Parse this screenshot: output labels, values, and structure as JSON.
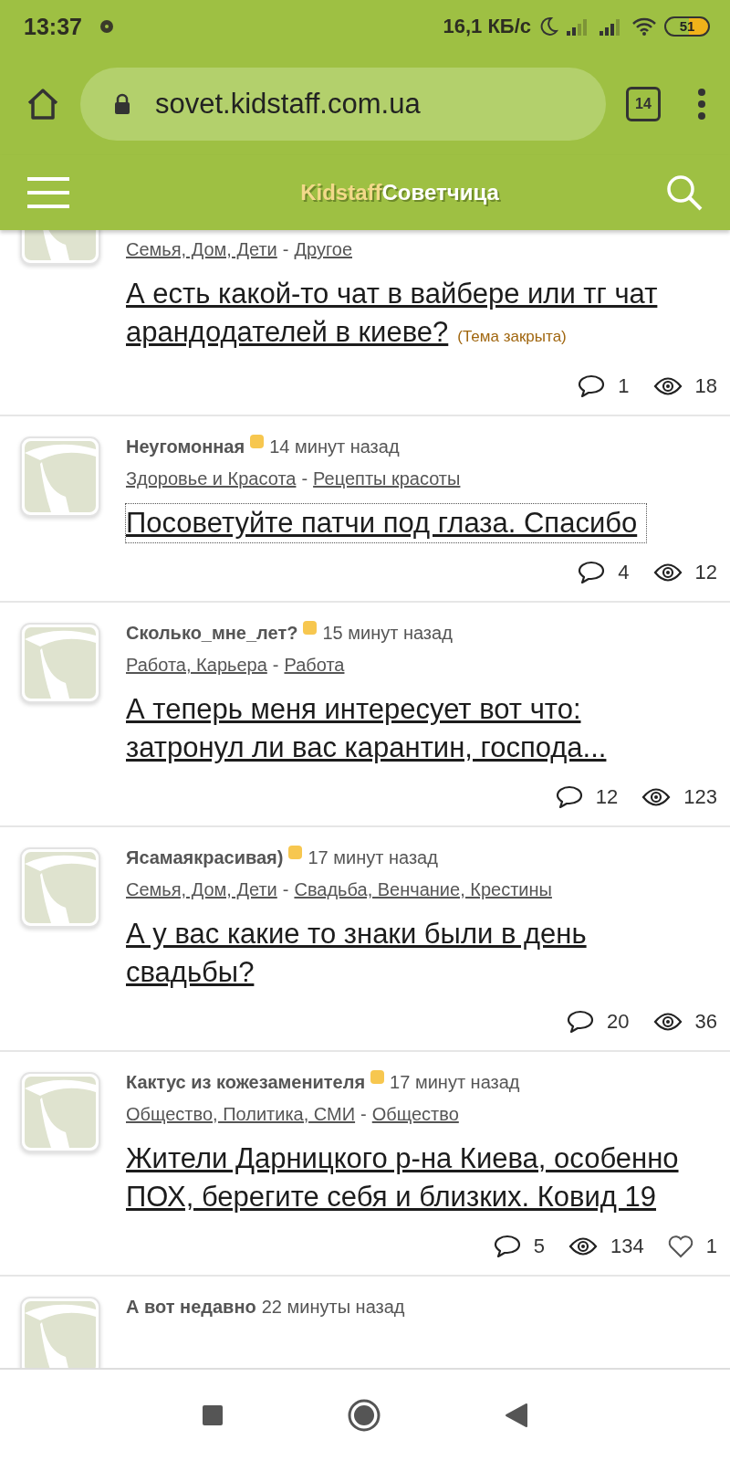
{
  "status_bar": {
    "time": "13:37",
    "speed": "16,1 КБ/с",
    "battery": "51"
  },
  "browser": {
    "url": "sovet.kidstaff.com.ua",
    "tabs_count": "14"
  },
  "site_header": {
    "logo_part1": "Kidstaff",
    "logo_part2": "Советчица"
  },
  "posts": [
    {
      "categories": [
        "Семья, Дом, Дети",
        "Другое"
      ],
      "separator": "-",
      "title_lines": [
        "А есть какой-то чат в вайбере или тг чат",
        "арандодателей в киеве?"
      ],
      "closed_label": "(Тема закрыта)",
      "focused": false,
      "comments": "1",
      "views": "18"
    },
    {
      "author": "Неугомонная",
      "online": true,
      "time": "14 минут назад",
      "categories": [
        "Здоровье и Красота",
        "Рецепты красоты"
      ],
      "separator": "-",
      "title_lines": [
        "Посоветуйте патчи под глаза. Спасибо"
      ],
      "focused": true,
      "comments": "4",
      "views": "12"
    },
    {
      "author": "Сколько_мне_лет?",
      "online": true,
      "time": "15 минут назад",
      "categories": [
        "Работа, Карьера",
        "Работа"
      ],
      "separator": "-",
      "title_lines": [
        "А теперь меня интересует вот что:",
        "затронул ли вас карантин, господа..."
      ],
      "focused": false,
      "comments": "12",
      "views": "123"
    },
    {
      "author": "Ясамаякрасивая)",
      "online": true,
      "time": "17 минут назад",
      "categories": [
        "Семья, Дом, Дети",
        "Свадьба, Венчание, Крестины"
      ],
      "separator": "-",
      "title_lines": [
        "А у вас какие то знаки были в день",
        "свадьбы?"
      ],
      "focused": false,
      "comments": "20",
      "views": "36"
    },
    {
      "author": "Кактус из кожезаменителя",
      "online": true,
      "time": "17 минут назад",
      "categories": [
        "Общество, Политика, СМИ",
        "Общество"
      ],
      "separator": "-",
      "title_lines": [
        "Жители Дарницкого р-на Киева, особенно",
        "ПОХ, берегите себя и близких. Ковид 19"
      ],
      "focused": false,
      "comments": "5",
      "views": "134",
      "likes": "1"
    },
    {
      "author": "А вот недавно",
      "online": false,
      "time": "22 минуты назад"
    }
  ]
}
